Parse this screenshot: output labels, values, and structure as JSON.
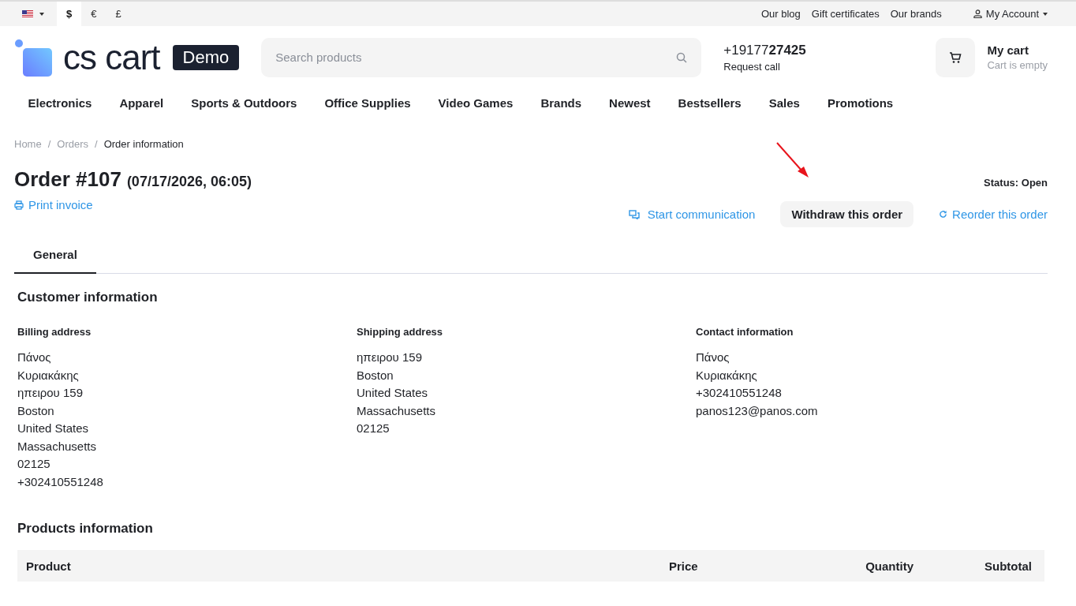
{
  "top_bar": {
    "currencies": [
      {
        "label": "$",
        "selected": true
      },
      {
        "label": "€",
        "selected": false
      },
      {
        "label": "£",
        "selected": false
      }
    ],
    "links": [
      "Our blog",
      "Gift certificates",
      "Our brands"
    ],
    "account": "My Account"
  },
  "header": {
    "logo": "cs cart",
    "badge": "Demo",
    "search": {
      "placeholder": "Search products"
    },
    "phone": {
      "prefix": "+19177",
      "main": "27425",
      "sub": "Request call"
    },
    "cart": {
      "title": "My cart",
      "sub": "Cart is empty"
    }
  },
  "nav": [
    "Electronics",
    "Apparel",
    "Sports & Outdoors",
    "Office Supplies",
    "Video Games",
    "Brands",
    "Newest",
    "Bestsellers",
    "Sales",
    "Promotions"
  ],
  "breadcrumbs": [
    "Home",
    "Orders",
    "Order information"
  ],
  "breadcrumb_separators": [
    "/",
    "/"
  ],
  "order": {
    "title": "Order #107",
    "date": "(07/17/2026, 06:05)",
    "status": "Status: Open",
    "print": "Print invoice",
    "start_communication": "Start communication",
    "withdraw": "Withdraw this order",
    "reorder": "Reorder this order"
  },
  "tabs": [
    {
      "label": "General",
      "selected": true
    }
  ],
  "customer": {
    "title": "Customer information",
    "columns": [
      {
        "title": "Billing address",
        "lines": [
          "Πάνος",
          "Κυριακάκης",
          "ηπειρου 159",
          "Boston",
          "United States",
          "Massachusetts",
          "02125",
          "+302410551248"
        ]
      },
      {
        "title": "Shipping address",
        "lines": [
          "ηπειρου 159",
          "Boston",
          "United States",
          "Massachusetts",
          "02125"
        ]
      },
      {
        "title": "Contact information",
        "lines": [
          "Πάνος",
          "Κυριακάκης",
          "+302410551248",
          "panos123@panos.com"
        ]
      }
    ]
  },
  "products": {
    "title": "Products information",
    "columns": [
      "Product",
      "Price",
      "Quantity",
      "Subtotal"
    ]
  }
}
